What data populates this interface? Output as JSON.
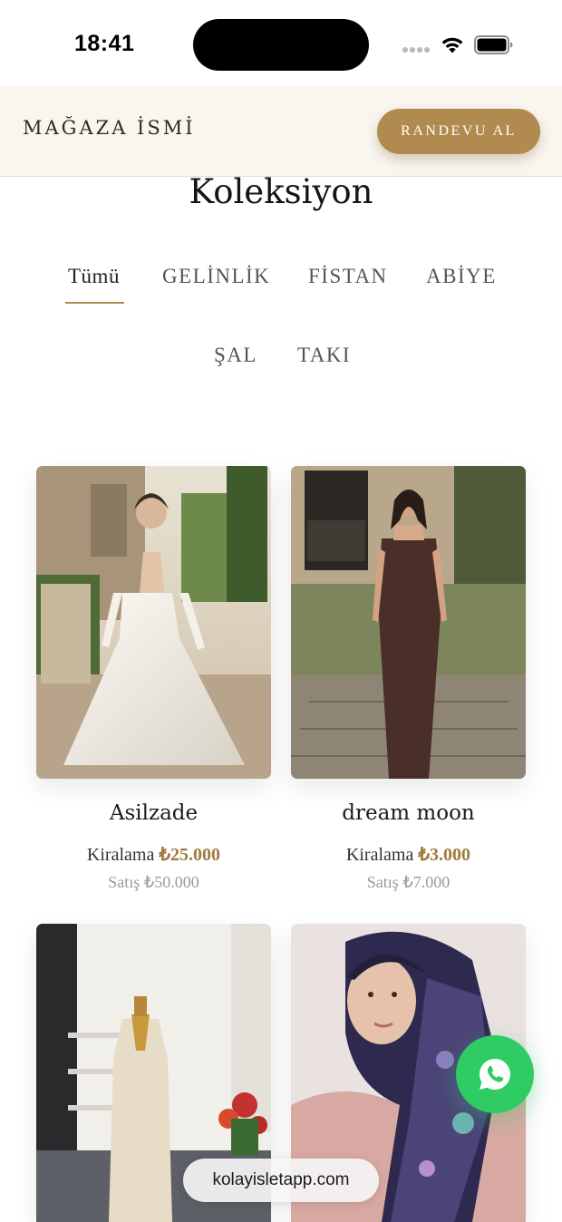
{
  "status_bar": {
    "time": "18:41",
    "icons": [
      "signal-dots-icon",
      "wifi-icon",
      "battery-icon"
    ]
  },
  "header": {
    "store_name": "MAĞAZA İSMİ",
    "cta_label": "RANDEVU AL"
  },
  "collection": {
    "title": "Koleksiyon",
    "tabs": [
      {
        "label": "Tümü",
        "active": true
      },
      {
        "label": "GELİNLİK",
        "active": false
      },
      {
        "label": "FİSTAN",
        "active": false
      },
      {
        "label": "ABİYE",
        "active": false
      },
      {
        "label": "ŞAL",
        "active": false
      },
      {
        "label": "TAKI",
        "active": false
      }
    ]
  },
  "products": [
    {
      "name": "Asilzade",
      "rent_label": "Kiralama",
      "rent_price": "₺25.000",
      "sale_text": "Satış ₺50.000",
      "image": "white-bridal-gown-photo"
    },
    {
      "name": "dream moon",
      "rent_label": "Kiralama",
      "rent_price": "₺3.000",
      "sale_text": "Satış ₺7.000",
      "image": "brown-satin-evening-dress-photo"
    },
    {
      "name": "",
      "rent_label": "",
      "rent_price": "",
      "sale_text": "",
      "image": "lace-kaftan-on-mannequin-photo"
    },
    {
      "name": "",
      "rent_label": "",
      "rent_price": "",
      "sale_text": "",
      "image": "patterned-silk-scarf-model-photo"
    }
  ],
  "floating": {
    "whatsapp_icon": "whatsapp-icon",
    "url_text": "kolayisletapp.com"
  },
  "colors": {
    "accent_gold": "#b08a4f",
    "header_bg": "#f9f5ef",
    "whatsapp_green": "#2ecc63"
  }
}
